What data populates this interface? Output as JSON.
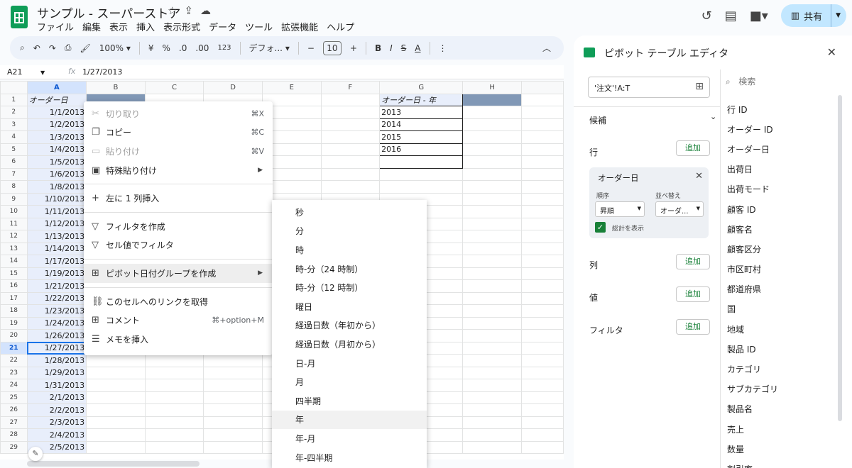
{
  "app": {
    "title": "サンプル - スーパーストア",
    "menu": [
      "ファイル",
      "編集",
      "表示",
      "挿入",
      "表示形式",
      "データ",
      "ツール",
      "拡張機能",
      "ヘルプ"
    ],
    "share_label": "共有"
  },
  "toolbar": {
    "zoom": "100%",
    "currency": "¥",
    "percent": "%",
    "dec_decrease": ".0",
    "dec_increase": ".00",
    "number_format": "123",
    "font": "デフォ...",
    "font_size": "10",
    "bold": "B",
    "italic": "I",
    "strike": "S",
    "text_color": "A"
  },
  "formula_bar": {
    "cell_ref": "A21",
    "fx": "fx",
    "value": "1/27/2013"
  },
  "grid": {
    "columns": [
      "A",
      "B",
      "C",
      "D",
      "E",
      "F",
      "G",
      "H"
    ],
    "rows": [
      "1",
      "2",
      "3",
      "4",
      "5",
      "6",
      "7",
      "8",
      "9",
      "10",
      "11",
      "12",
      "13",
      "14",
      "15",
      "16",
      "17",
      "18",
      "19",
      "20",
      "21",
      "22",
      "23",
      "24",
      "25",
      "26",
      "27",
      "28",
      "29"
    ],
    "col_a": [
      "オーダー日",
      "1/1/2013",
      "1/2/2013",
      "1/3/2013",
      "1/4/2013",
      "1/5/2013",
      "1/6/2013",
      "1/8/2013",
      "1/10/2013",
      "1/11/2013",
      "1/12/2013",
      "1/13/2013",
      "1/14/2013",
      "1/17/2013",
      "1/19/2013",
      "1/21/2013",
      "1/22/2013",
      "1/23/2013",
      "1/24/2013",
      "1/26/2013",
      "1/27/2013",
      "1/28/2013",
      "1/29/2013",
      "1/31/2013",
      "2/1/2013",
      "2/2/2013",
      "2/3/2013",
      "2/4/2013",
      "2/5/2013"
    ],
    "col_g": [
      "オーダー日 - 年",
      "2013",
      "2014",
      "2015",
      "2016",
      ""
    ]
  },
  "context_menu": {
    "items": [
      {
        "label": "切り取り",
        "shortcut": "⌘X",
        "icon": "scissors-icon"
      },
      {
        "label": "コピー",
        "shortcut": "⌘C",
        "icon": "copy-icon"
      },
      {
        "label": "貼り付け",
        "shortcut": "⌘V",
        "icon": "clipboard-icon"
      },
      {
        "label": "特殊貼り付け",
        "icon": "clipboard-icon"
      },
      {
        "label": "左に 1 列挿入",
        "icon": "plus-icon"
      },
      {
        "label": "フィルタを作成",
        "icon": "filter-icon"
      },
      {
        "label": "セル値でフィルタ",
        "icon": "filter-icon"
      },
      {
        "label": "ピボット日付グループを作成",
        "icon": "plus-box-icon"
      },
      {
        "label": "このセルへのリンクを取得",
        "icon": "link-icon"
      },
      {
        "label": "コメント",
        "shortcut": "⌘+option+M",
        "icon": "comment-icon"
      },
      {
        "label": "メモを挿入",
        "icon": "note-icon"
      }
    ]
  },
  "submenu": {
    "items": [
      "秒",
      "分",
      "時",
      "時-分（24 時制）",
      "時-分（12 時制）",
      "曜日",
      "経過日数（年初から）",
      "経過日数（月初から）",
      "日-月",
      "月",
      "四半期",
      "年",
      "年-月",
      "年-四半期"
    ]
  },
  "pivot_editor": {
    "title": "ピボット テーブル エディタ",
    "range": "'注文'!A:T",
    "suggestions": "候補",
    "rows_label": "行",
    "columns_label": "列",
    "values_label": "値",
    "filter_label": "フィルタ",
    "add_label": "追加",
    "card": {
      "title": "オーダー日",
      "order_label": "順序",
      "order_value": "昇順",
      "sort_label": "並べ替え",
      "sort_value": "オーダ...",
      "totals_label": "総計を表示"
    },
    "search_placeholder": "検索",
    "fields": [
      "行 ID",
      "オーダー ID",
      "オーダー日",
      "出荷日",
      "出荷モード",
      "顧客 ID",
      "顧客名",
      "顧客区分",
      "市区町村",
      "都道府県",
      "国",
      "地域",
      "製品 ID",
      "カテゴリ",
      "サブカテゴリ",
      "製品名",
      "売上",
      "数量",
      "割引率"
    ]
  }
}
